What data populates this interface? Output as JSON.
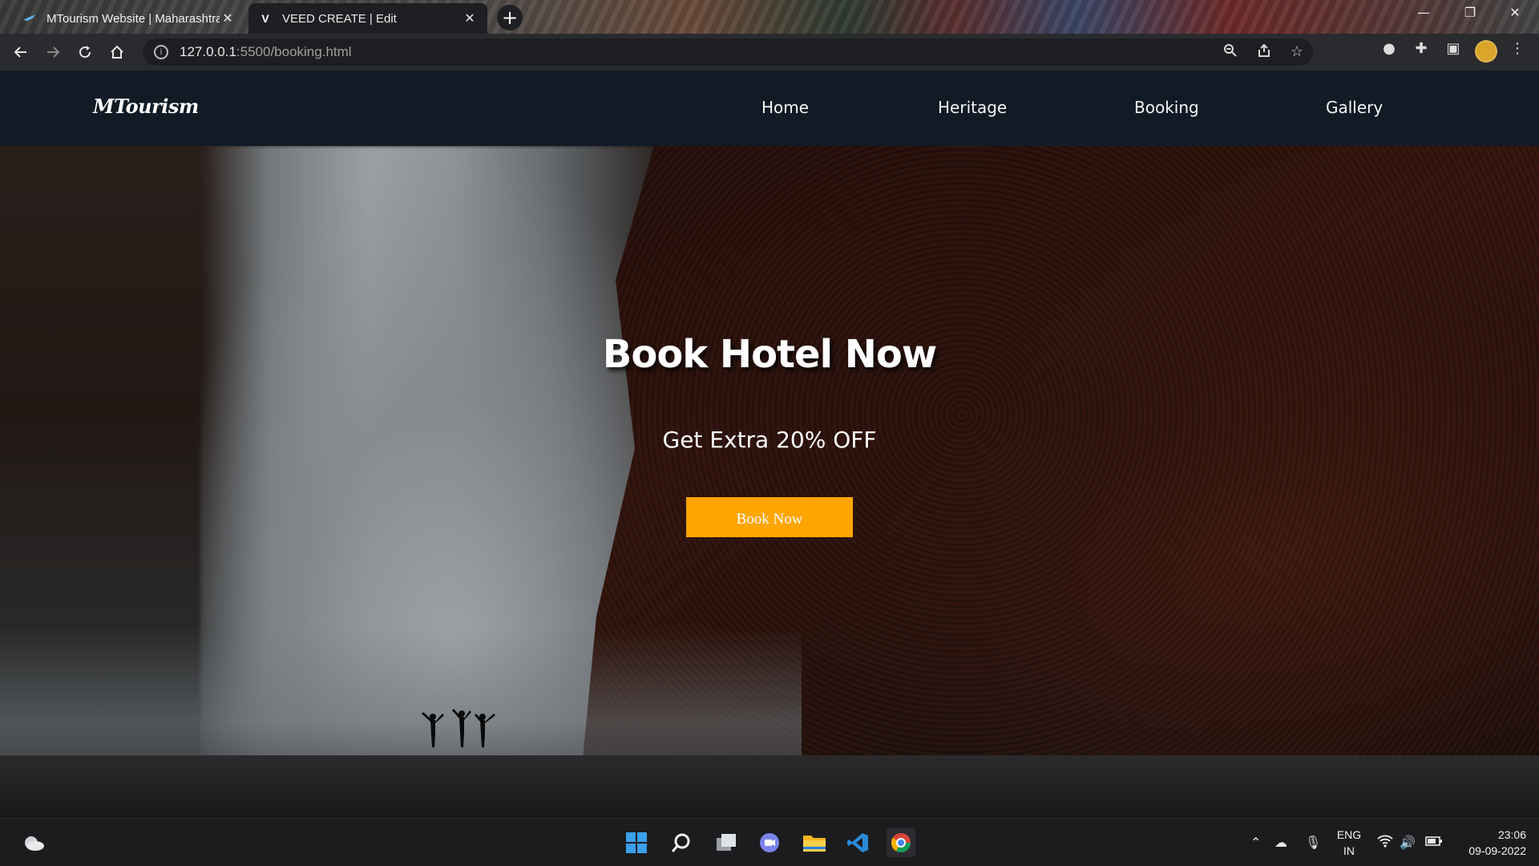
{
  "browser": {
    "tabs": [
      {
        "title": "MTourism Website | Maharashtra",
        "active": false
      },
      {
        "title": "VEED CREATE | Edit",
        "active": true,
        "favicon": "V"
      }
    ],
    "new_tab": "+",
    "url_host": "127.0.0.1",
    "url_path": ":5500/booking.html"
  },
  "site": {
    "logo": "MTourism",
    "nav": [
      "Home",
      "Heritage",
      "Booking",
      "Gallery"
    ],
    "hero": {
      "title": "Book Hotel Now",
      "subtitle": "Get Extra 20% OFF",
      "button": "Book Now"
    },
    "colors": {
      "nav_bg": "#111b26",
      "accent": "#ffa500"
    }
  },
  "taskbar": {
    "lang_1": "ENG",
    "lang_2": "IN",
    "time": "23:06",
    "date": "09-09-2022"
  }
}
